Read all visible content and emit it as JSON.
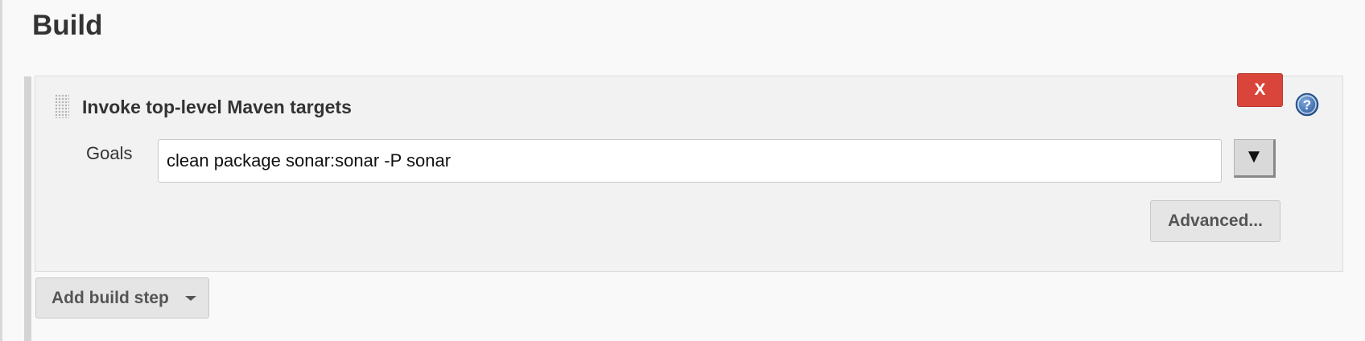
{
  "section": {
    "title": "Build"
  },
  "build_step": {
    "title": "Invoke top-level Maven targets",
    "delete_label": "X",
    "goals_label": "Goals",
    "goals_value": "clean package sonar:sonar -P sonar",
    "expand_label": "▼",
    "advanced_label": "Advanced..."
  },
  "add_step": {
    "label": "Add build step"
  },
  "colors": {
    "delete_red": "#d9453a",
    "help_blue": "#3a6fb0",
    "panel_bg": "#f2f2f2",
    "page_bg": "#f9f9f9"
  },
  "icons": {
    "drag": "drag-handle-icon",
    "help": "help-icon",
    "expand": "triangle-down",
    "dropdown": "caret-down-icon"
  }
}
